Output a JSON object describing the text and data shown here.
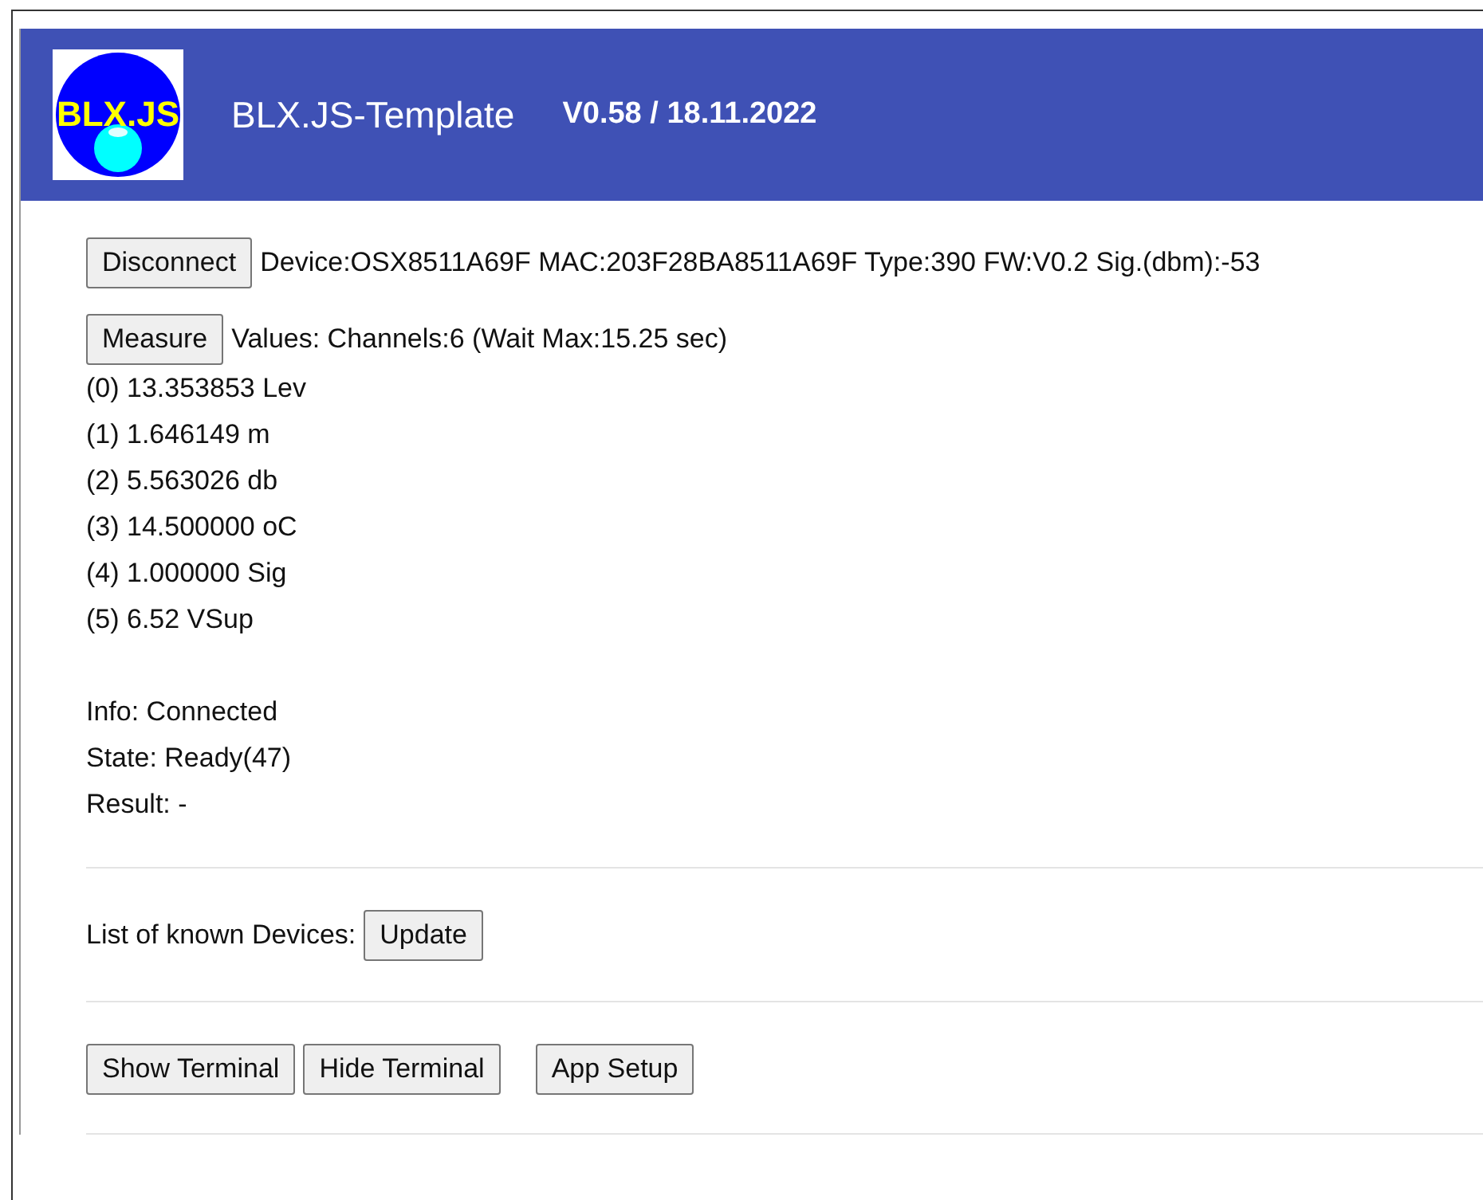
{
  "header": {
    "logo_text": "BLX.JS",
    "title": "BLX.JS-Template",
    "version": "V0.58 / 18.11.2022"
  },
  "device": {
    "button": "Disconnect",
    "info": "Device:OSX8511A69F MAC:203F28BA8511A69F Type:390 FW:V0.2 Sig.(dbm):-53"
  },
  "measure": {
    "button": "Measure",
    "info": "Values: Channels:6 (Wait Max:15.25 sec)"
  },
  "values": [
    "(0) 13.353853 Lev",
    "(1) 1.646149 m",
    "(2) 5.563026 db",
    "(3) 14.500000 oC",
    "(4) 1.000000 Sig",
    "(5) 6.52 VSup"
  ],
  "status": [
    "Info: Connected",
    "State: Ready(47)",
    "Result: -"
  ],
  "devices": {
    "label": "List of known Devices:",
    "button": "Update"
  },
  "terminal_buttons": [
    "Show Terminal",
    "Hide Terminal"
  ],
  "setup_button": "App Setup"
}
